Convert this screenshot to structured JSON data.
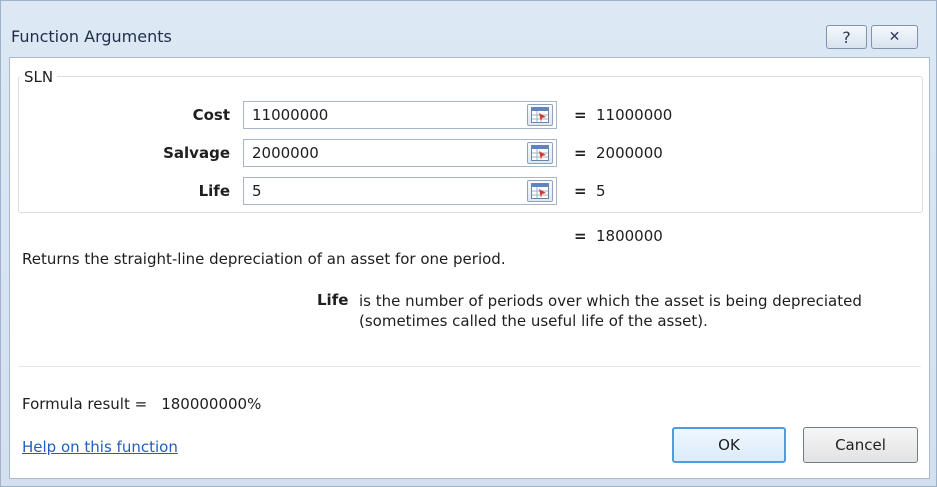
{
  "dialog": {
    "title": "Function Arguments",
    "help_glyph": "?",
    "close_glyph": "✕"
  },
  "function": {
    "name": "SLN",
    "args": [
      {
        "label": "Cost",
        "value": "11000000",
        "eq": "=",
        "result": "11000000"
      },
      {
        "label": "Salvage",
        "value": "2000000",
        "eq": "=",
        "result": "2000000"
      },
      {
        "label": "Life",
        "value": "5",
        "eq": "=",
        "result": "5"
      }
    ],
    "overall_eq": "=",
    "overall_result": "1800000",
    "description": "Returns the straight-line depreciation of an asset for one period.",
    "current_arg_name": "Life",
    "current_arg_description": "is the number of periods over which the asset is being depreciated (sometimes called the useful life of the asset)."
  },
  "footer": {
    "formula_label": "Formula result =",
    "formula_value": "180000000%",
    "help_link": "Help on this function",
    "ok_label": "OK",
    "cancel_label": "Cancel"
  },
  "icons": {
    "ref_button": "collapse-dialog-icon",
    "help": "help-icon",
    "close": "close-icon"
  },
  "colors": {
    "title_bar": "#d2e0ef",
    "link": "#1f5fbf",
    "ok_border": "#4f9ddf"
  }
}
